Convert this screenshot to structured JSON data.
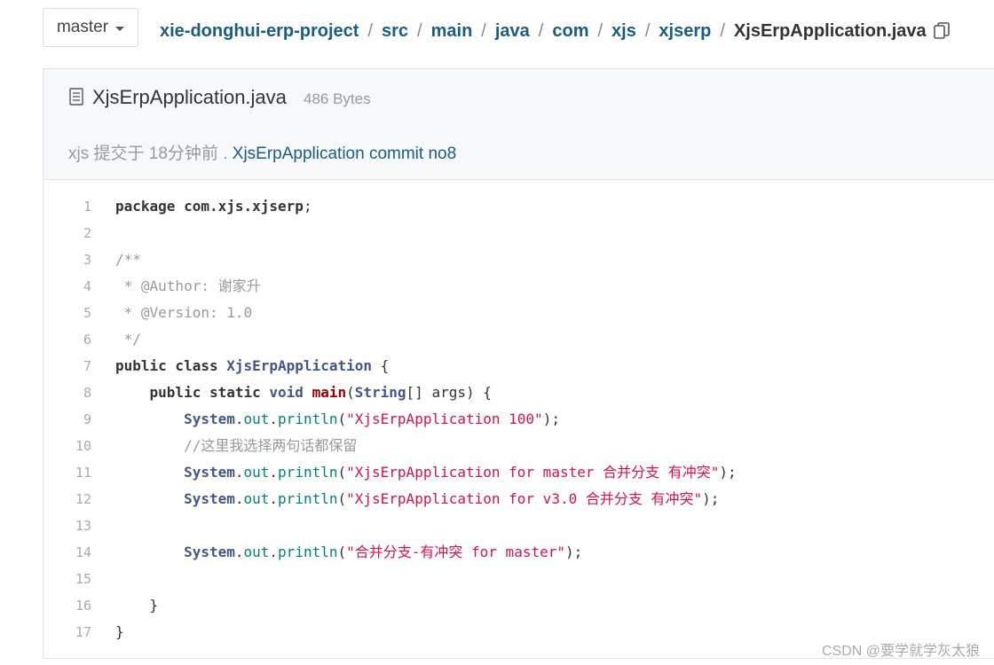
{
  "branch": {
    "label": "master"
  },
  "breadcrumb": {
    "items": [
      "xie-donghui-erp-project",
      "src",
      "main",
      "java",
      "com",
      "xjs",
      "xjserp"
    ],
    "current": "XjsErpApplication.java",
    "separator": "/"
  },
  "file": {
    "name": "XjsErpApplication.java",
    "size": "486 Bytes",
    "commit_prefix": "xjs 提交于 18分钟前 .",
    "commit_message": "XjsErpApplication commit no8"
  },
  "code": {
    "line_numbers": [
      "1",
      "2",
      "3",
      "4",
      "5",
      "6",
      "7",
      "8",
      "9",
      "10",
      "11",
      "12",
      "13",
      "14",
      "15",
      "16",
      "17"
    ],
    "l1": {
      "kw": "package",
      "pkg": "com.xjs.xjserp",
      "end": ";"
    },
    "l3": "/**",
    "l4": " * @Author: 谢家升",
    "l5": " * @Version: 1.0",
    "l6": " */",
    "l7": {
      "kw": "public class",
      "cls": "XjsErpApplication",
      "end": " {"
    },
    "l8": {
      "kw": "public static",
      "type": "void",
      "fn": "main",
      "open": "(",
      "param_type": "String",
      "params": "[] args) {"
    },
    "l9": {
      "str": "\"XjsErpApplication 100\""
    },
    "l10": "//这里我选择两句话都保留",
    "l11": {
      "str": "\"XjsErpApplication for master 合并分支 有冲突\""
    },
    "l12": {
      "str": "\"XjsErpApplication for v3.0 合并分支 有冲突\""
    },
    "l14": {
      "str": "\"合并分支-有冲突 for master\""
    },
    "l16": "}",
    "l17": "}",
    "call": {
      "sys": "System",
      "dot1": ".",
      "out": "out",
      "dot2": ".",
      "method": "println",
      "open": "(",
      "close": ");"
    }
  },
  "watermark": "CSDN @要学就学灰太狼"
}
